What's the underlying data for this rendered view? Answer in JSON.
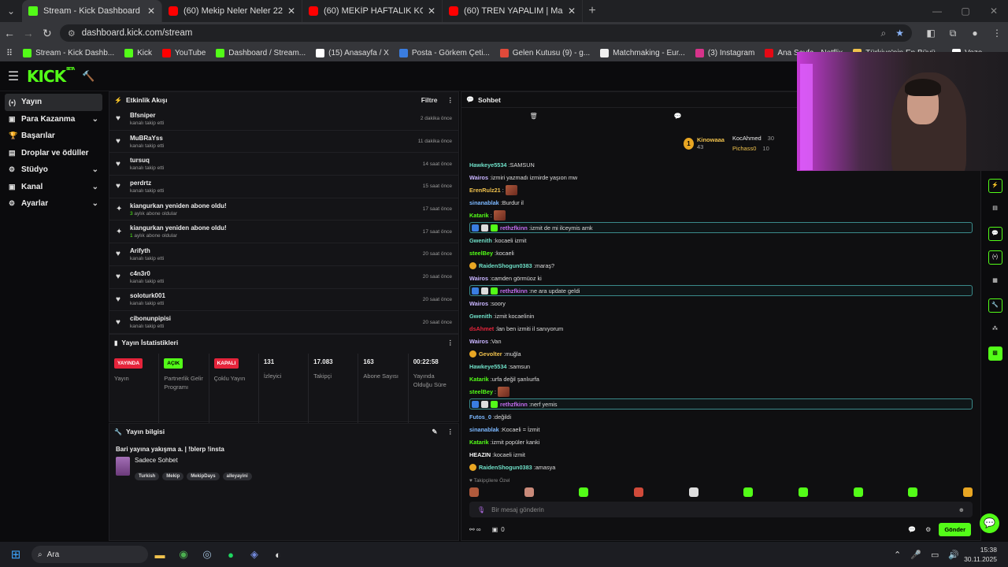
{
  "tabs": [
    {
      "title": "Stream - Kick Dashboard",
      "type": "kick",
      "active": true
    },
    {
      "title": "(60) Mekip Neler Neler 22.Bölü",
      "type": "yt"
    },
    {
      "title": "(60) MEKİP HAFTALIK KOMİK A",
      "type": "yt"
    },
    {
      "title": "(60) TREN YAPALIM | Madara O",
      "type": "yt"
    }
  ],
  "address": {
    "url": "dashboard.kick.com/stream"
  },
  "bookmarks": [
    {
      "label": "Stream - Kick Dashb...",
      "color": "#53fc18"
    },
    {
      "label": "Kick",
      "color": "#53fc18"
    },
    {
      "label": "YouTube",
      "color": "#ff0000"
    },
    {
      "label": "Dashboard / Stream...",
      "color": "#53fc18"
    },
    {
      "label": "(15) Anasayfa / X",
      "color": "#ffffff"
    },
    {
      "label": "Posta - Görkem Çeti...",
      "color": "#3a7de0"
    },
    {
      "label": "Gelen Kutusu (9) - g...",
      "color": "#e04a3a"
    },
    {
      "label": "Matchmaking - Eur...",
      "color": "#f0f0f0"
    },
    {
      "label": "(3) Instagram",
      "color": "#d6338a"
    },
    {
      "label": "Ana Sayfa - Netflix",
      "color": "#e50914"
    },
    {
      "label": "Türkiye'nin En Büyü...",
      "color": "#f0c24d"
    },
    {
      "label": "Vozo...",
      "color": "#ffffff"
    }
  ],
  "sidebar": [
    {
      "label": "Yayın",
      "icon": "(•)",
      "active": true,
      "chevron": false
    },
    {
      "label": "Para Kazanma",
      "icon": "▣",
      "chevron": true
    },
    {
      "label": "Başarılar",
      "icon": "🏆",
      "chevron": false
    },
    {
      "label": "Droplar ve ödüller",
      "icon": "▤",
      "chevron": false
    },
    {
      "label": "Stüdyo",
      "icon": "⚙",
      "chevron": true
    },
    {
      "label": "Kanal",
      "icon": "▣",
      "chevron": true
    },
    {
      "label": "Ayarlar",
      "icon": "⚙",
      "chevron": true
    }
  ],
  "activity": {
    "title": "Etkinlik Akışı",
    "filter": "Filtre",
    "items": [
      {
        "name": "Bfsniper",
        "sub": "kanalı takip etti",
        "time": "2 dakika önce",
        "kind": "follow"
      },
      {
        "name": "MuBRaYss",
        "sub": "kanalı takip etti",
        "time": "11 dakika önce",
        "kind": "follow"
      },
      {
        "name": "tursuq",
        "sub": "kanalı takip etti",
        "time": "14 saat önce",
        "kind": "follow"
      },
      {
        "name": "perdrtz",
        "sub": "kanalı takip etti",
        "time": "15 saat önce",
        "kind": "follow"
      },
      {
        "name": "kiangurkan yeniden abone oldu!",
        "sub_num": "3",
        "sub": " aylık abone oldular",
        "time": "17 saat önce",
        "kind": "sub"
      },
      {
        "name": "kiangurkan yeniden abone oldu!",
        "sub_num": "1",
        "sub": " aylık abone oldular",
        "time": "17 saat önce",
        "kind": "sub"
      },
      {
        "name": "Arifyth",
        "sub": "kanalı takip etti",
        "time": "20 saat önce",
        "kind": "follow"
      },
      {
        "name": "c4n3r0",
        "sub": "kanalı takip etti",
        "time": "20 saat önce",
        "kind": "follow"
      },
      {
        "name": "soloturk001",
        "sub": "kanalı takip etti",
        "time": "20 saat önce",
        "kind": "follow"
      },
      {
        "name": "cibonunpipisi",
        "sub": "kanalı takip etti",
        "time": "20 saat önce",
        "kind": "follow"
      }
    ]
  },
  "stats": {
    "title": "Yayın İstatistikleri",
    "items": [
      {
        "badge": "YAYINDA",
        "badge_color": "red",
        "label": "Yayın"
      },
      {
        "badge": "AÇIK",
        "badge_color": "green",
        "label": "Partnerlik Gelir Programı"
      },
      {
        "badge": "KAPALI",
        "badge_color": "red",
        "label": "Çoklu Yayın"
      },
      {
        "value": "131",
        "label": "İzleyici"
      },
      {
        "value": "17.083",
        "label": "Takipçi"
      },
      {
        "value": "163",
        "label": "Abone Sayısı"
      },
      {
        "value": "00:22:58",
        "label": "Yayında Olduğu Süre"
      }
    ]
  },
  "stream_info": {
    "header": "Yayın bilgisi",
    "title": "Bari yayına yakışma a. | !blerp !insta",
    "category": "Sadece Sohbet",
    "tags": [
      "Turkish",
      "Mekip",
      "MekipDays",
      "alleyayini"
    ]
  },
  "chat": {
    "title": "Sohbet",
    "leader1": {
      "name": "Kinowaaa",
      "count": "43",
      "rank": "1"
    },
    "leader2": [
      {
        "name": "KocAhmed",
        "count": "30"
      },
      {
        "name": "Pichass0",
        "count": "10"
      }
    ],
    "messages": [
      {
        "user": "Hawkeye5534",
        "color": "#6fe0c8",
        "text": "SAMSUN"
      },
      {
        "user": "Wairos",
        "color": "#c9b5ff",
        "text": "izmiri yazmadı izmirde yaşıon mw"
      },
      {
        "user": "ErenRulz21",
        "color": "#f0c24d",
        "text": "",
        "emote": true
      },
      {
        "user": "sinanablak",
        "color": "#7cb8ff",
        "text": "Burdur il"
      },
      {
        "user": "Katarik",
        "color": "#53fc18",
        "text": "",
        "emote": true
      },
      {
        "user": "rethzfkinn",
        "color": "#c56cf0",
        "text": "izmit de mi ilceymis amk",
        "hl": true
      },
      {
        "user": "Gwenith",
        "color": "#6fe0c8",
        "text": "kocaeli izmit"
      },
      {
        "user": "steelBey",
        "color": "#53fc18",
        "text": "kocaeli"
      },
      {
        "user": "RaidenShogun0383",
        "color": "#6fe0c8",
        "text": "maraş?",
        "badge": true
      },
      {
        "user": "Wairos",
        "color": "#c9b5ff",
        "text": "camden görmüoz ki"
      },
      {
        "user": "rethzfkinn",
        "color": "#c56cf0",
        "text": "ne ara update geldi",
        "hl": true
      },
      {
        "user": "Wairos",
        "color": "#c9b5ff",
        "text": "soory"
      },
      {
        "user": "Gwenith",
        "color": "#6fe0c8",
        "text": "izmit kocaelinin"
      },
      {
        "user": "dsAhmet",
        "color": "#e5243b",
        "text": "lan ben izmiti il sanıyorum"
      },
      {
        "user": "Wairos",
        "color": "#c9b5ff",
        "text": "Van"
      },
      {
        "user": "Gevolter",
        "color": "#f0c24d",
        "text": "muğla",
        "badge": true
      },
      {
        "user": "Hawkeye5534",
        "color": "#6fe0c8",
        "text": "samsun"
      },
      {
        "user": "Katarik",
        "color": "#53fc18",
        "text": "urfa değil şanlıurfa"
      },
      {
        "user": "steelBey",
        "color": "#53fc18",
        "text": "",
        "emote": true
      },
      {
        "user": "rethzfkinn",
        "color": "#c56cf0",
        "text": "nerf yemis",
        "hl": true
      },
      {
        "user": "Futos_0",
        "color": "#7cb8ff",
        "text": "değildi"
      },
      {
        "user": "sinanablak",
        "color": "#7cb8ff",
        "text": "Kocaeli = İzmit"
      },
      {
        "user": "Katarik",
        "color": "#53fc18",
        "text": "izmit popüler kanki"
      },
      {
        "user": "HEAZIN",
        "color": "#f5f5f5",
        "text": "kocaeli izmit"
      },
      {
        "user": "RaidenShogun0383",
        "color": "#6fe0c8",
        "text": "amasya",
        "badge": true
      }
    ],
    "followers_only": "Takipçilere Özel",
    "input_placeholder": "Bir mesaj gönderin",
    "footer_count": "0",
    "send": "Gönder"
  },
  "taskbar": {
    "search": "Ara",
    "time": "15:38",
    "date": "30.11.2025"
  }
}
